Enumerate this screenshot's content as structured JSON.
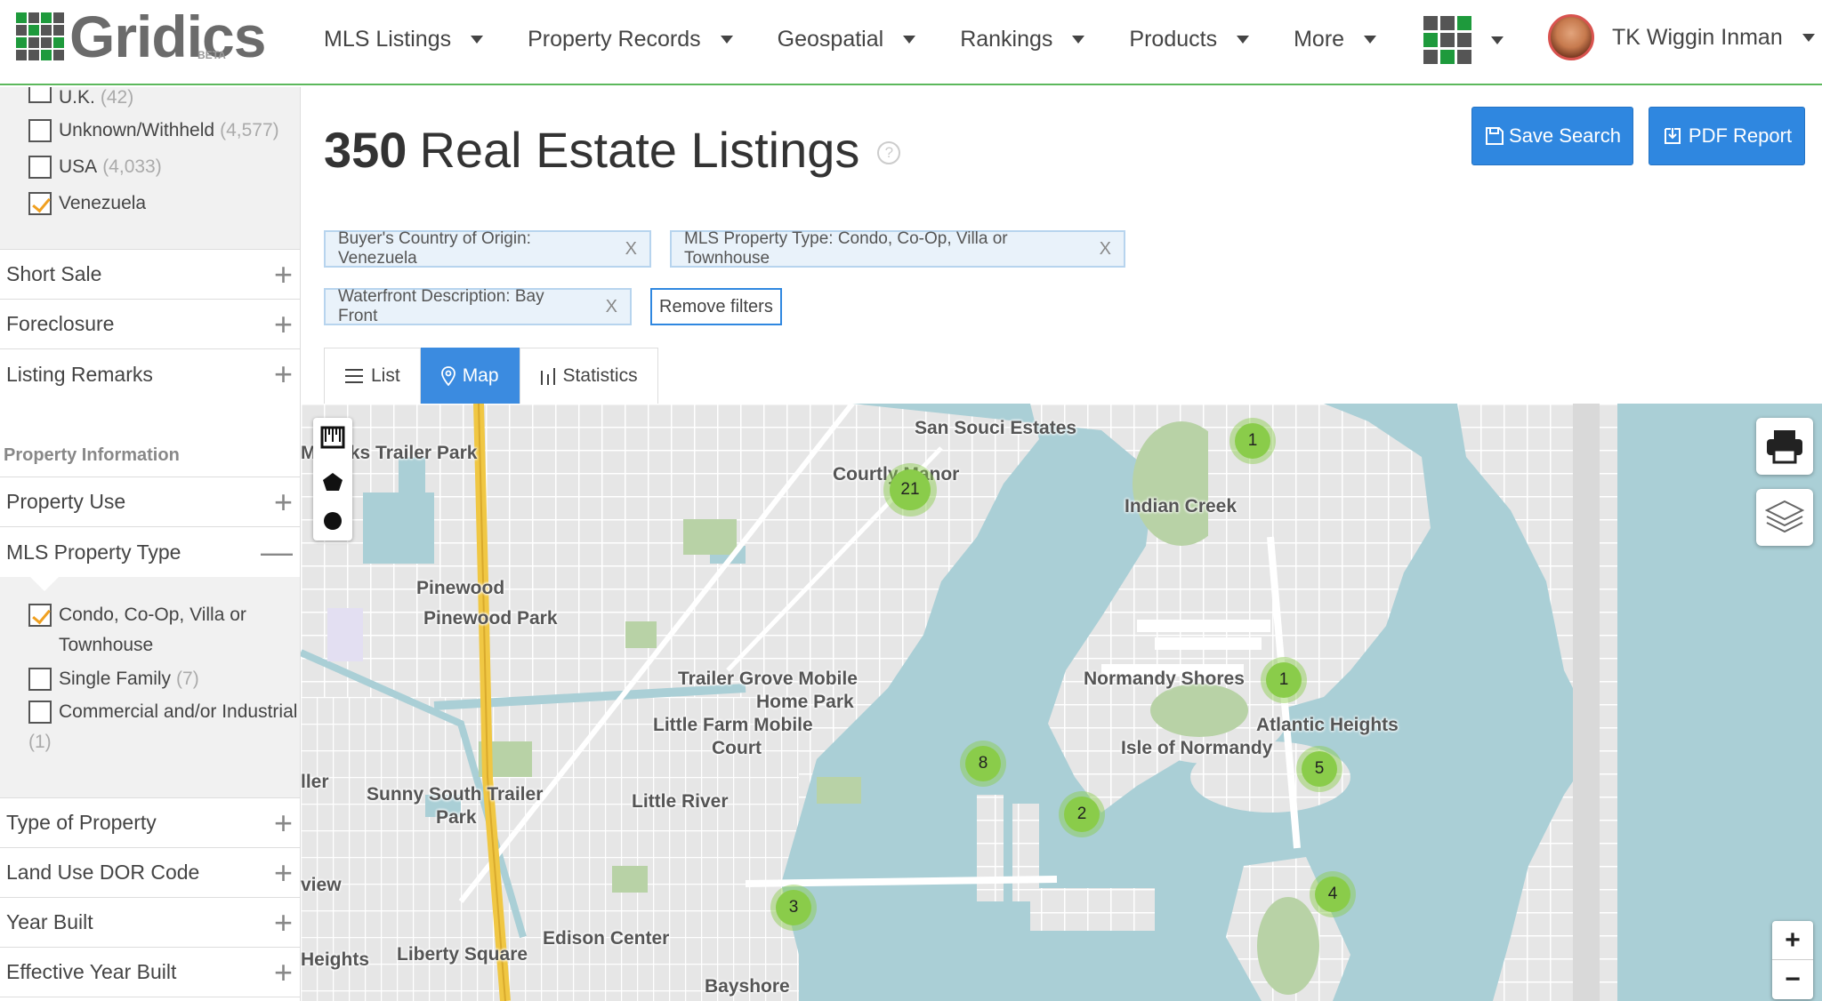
{
  "brand": {
    "name": "Gridics",
    "badge": "BETA"
  },
  "nav": {
    "items": [
      "MLS Listings",
      "Property Records",
      "Geospatial",
      "Rankings",
      "Products",
      "More"
    ],
    "user_name": "TK Wiggin Inman"
  },
  "sidebar": {
    "country_options": [
      {
        "label": "U.K.",
        "count": "(42)",
        "checked": false
      },
      {
        "label": "Unknown/Withheld",
        "count": "(4,577)",
        "checked": false
      },
      {
        "label": "USA",
        "count": "(4,033)",
        "checked": false
      },
      {
        "label": "Venezuela",
        "count": "",
        "checked": true
      }
    ],
    "sections_top": [
      "Short Sale",
      "Foreclosure",
      "Listing Remarks"
    ],
    "property_info_title": "Property Information",
    "property_use": "Property Use",
    "mls_type": {
      "label": "MLS Property Type",
      "options": [
        {
          "label": "Condo, Co-Op, Villa or Townhouse",
          "count": "",
          "checked": true
        },
        {
          "label": "Single Family",
          "count": "(7)",
          "checked": false
        },
        {
          "label": "Commercial and/or Industrial",
          "count": "(1)",
          "checked": false
        }
      ]
    },
    "sections_bottom": [
      "Type of Property",
      "Land Use DOR Code",
      "Year Built",
      "Effective Year Built"
    ]
  },
  "main": {
    "count": "350",
    "title": "Real Estate Listings",
    "save_button": "Save Search",
    "pdf_button": "PDF Report",
    "filters": [
      "Buyer's Country of Origin: Venezuela",
      "MLS Property Type: Condo, Co-Op, Villa or Townhouse",
      "Waterfront Description: Bay Front"
    ],
    "remove_filters": "Remove filters",
    "tabs": [
      "List",
      "Map",
      "Statistics"
    ],
    "active_tab": "Map"
  },
  "map": {
    "labels": [
      "San Souci Estates",
      "Myricks Trailer Park",
      "Courtly Manor",
      "Indian Creek",
      "Pinewood",
      "Pinewood Park",
      "Trailer Grove Mobile",
      "Home Park",
      "Normandy Shores",
      "Atlantic Heights",
      "Little Farm Mobile",
      "Court",
      "Isle of Normandy",
      "ller",
      "Sunny South Trailer",
      "Park",
      "Little River",
      "view",
      "Edison Center",
      "Heights",
      "Liberty Square",
      "Bayshore"
    ],
    "clusters": [
      "1",
      "21",
      "1",
      "8",
      "5",
      "2",
      "4",
      "3"
    ],
    "zoom_in": "+",
    "zoom_out": "−",
    "colors": {
      "water": "#aacfd6",
      "land": "#e8e8e8",
      "park": "#b8d2a6",
      "cluster": "#8acc4a",
      "accent": "#2f87e0"
    }
  }
}
